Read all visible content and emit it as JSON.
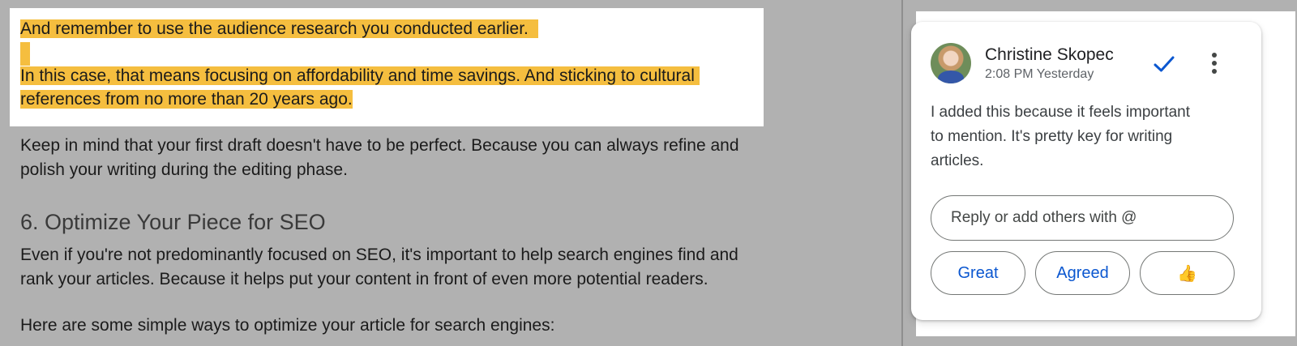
{
  "document": {
    "highlight_lines": [
      "And remember to use the audience research you conducted earlier.",
      "In this case, that means focusing on affordability and time savings. And sticking to cultural",
      "references from no more than 20 years ago."
    ],
    "paragraph1_lines": [
      "Keep in mind that your first draft doesn't have to be perfect. Because you can always refine and",
      "polish your writing during the editing phase."
    ],
    "heading": "6. Optimize Your Piece for SEO",
    "paragraph2_lines": [
      "Even if you're not predominantly focused on SEO, it's important to help search engines find and",
      "rank your articles. Because it helps put your content in front of even more potential readers."
    ],
    "paragraph3": "Here are some simple ways to optimize your article for search engines:"
  },
  "comment": {
    "author": "Christine Skopec",
    "timestamp": "2:08 PM Yesterday",
    "body": "I added this because it feels important to mention. It's pretty key for writing articles.",
    "reply_placeholder": "Reply or add others with @",
    "quick_replies": [
      "Great",
      "Agreed",
      "👍"
    ],
    "icons": {
      "resolve": "checkmark-icon",
      "more": "more-vert-icon"
    }
  },
  "colors": {
    "highlight": "#f5be3f",
    "accent": "#0b57d0",
    "background": "#b1b1b1"
  }
}
